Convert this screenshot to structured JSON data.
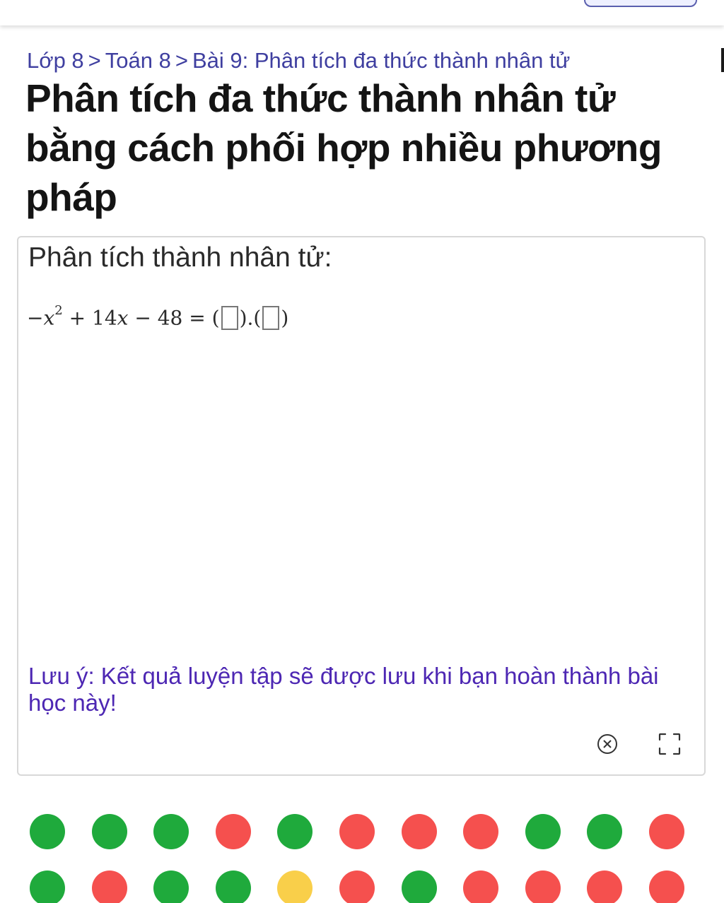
{
  "breadcrumb": {
    "items": [
      "Lớp 8",
      "Toán 8",
      "Bài 9: Phân tích đa thức thành nhân tử"
    ],
    "separator": ">"
  },
  "page_title": "Phân tích đa thức thành nhân tử bằng cách phối hợp nhiều phương pháp",
  "exercise": {
    "question_label": "Phân tích thành nhân tử:",
    "equation": {
      "minus": "−",
      "var": "x",
      "exponent": "2",
      "plus": "+",
      "coef": "14",
      "minus2": "−",
      "constant": "48",
      "equals": "=",
      "open1": "(",
      "close1": ")",
      "dot": ".",
      "open2": "(",
      "close2": ")"
    },
    "note": "Lưu ý: Kết quả luyện tập sẽ được lưu khi bạn hoàn thành bài học này!",
    "close_icon": "close-circle-icon",
    "fullscreen_icon": "fullscreen-icon"
  },
  "progress": {
    "colors": {
      "correct": "#1faa3c",
      "wrong": "#f5504e",
      "current": "#f9cf4a"
    },
    "row1": [
      "correct",
      "correct",
      "correct",
      "wrong",
      "correct",
      "wrong",
      "wrong",
      "wrong",
      "correct",
      "correct",
      "wrong"
    ],
    "row2": [
      "correct",
      "wrong",
      "correct",
      "correct",
      "current",
      "wrong",
      "correct",
      "wrong",
      "wrong",
      "wrong",
      "wrong"
    ]
  },
  "colors": {
    "breadcrumb": "#3f3fa0",
    "note": "#4d27b3"
  }
}
